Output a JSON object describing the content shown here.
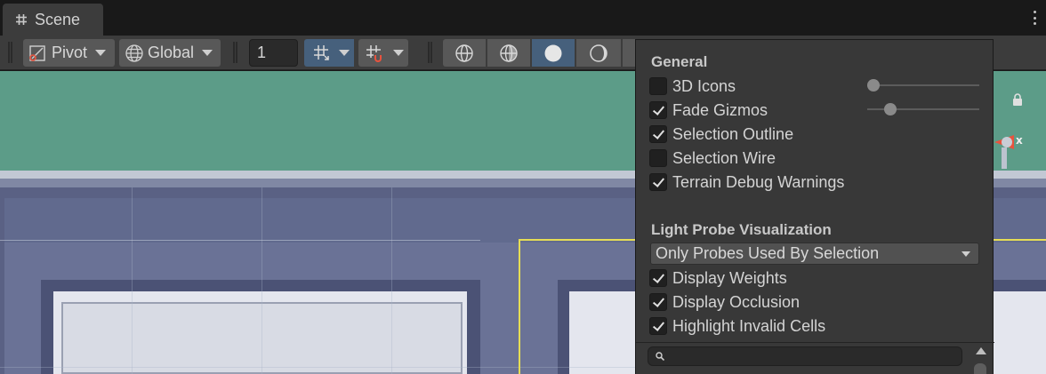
{
  "tab": {
    "title": "Scene",
    "icon": "grid-hash-icon"
  },
  "toolbar": {
    "pivot_label": "Pivot",
    "global_label": "Global",
    "snap_value": "1",
    "grid_snap_icon": "grid-snap-icon",
    "increment_snap_icon": "magnet-grid-icon",
    "shading_modes": [
      "wireframe-sphere-icon",
      "shaded-wireframe-sphere-icon",
      "solid-sphere-icon",
      "moon-sphere-icon"
    ],
    "active_shading": "solid-sphere-icon",
    "orientation_icon": "globe-gizmo-icon"
  },
  "overlay": {
    "general_heading": "General",
    "general_items": [
      {
        "label": "3D Icons",
        "checked": false,
        "slider": 0.0
      },
      {
        "label": "Fade Gizmos",
        "checked": true,
        "slider": 0.2
      },
      {
        "label": "Selection Outline",
        "checked": true
      },
      {
        "label": "Selection Wire",
        "checked": false
      },
      {
        "label": "Terrain Debug Warnings",
        "checked": true
      }
    ],
    "light_probe_heading": "Light Probe Visualization",
    "light_probe_mode": "Only Probes Used By Selection",
    "light_probe_items": [
      {
        "label": "Display Weights",
        "checked": true
      },
      {
        "label": "Display Occlusion",
        "checked": true
      },
      {
        "label": "Highlight Invalid Cells",
        "checked": true
      }
    ],
    "search_placeholder": ""
  },
  "colors": {
    "accent_selection": "#e6dd55",
    "active_toggle": "#46607c",
    "gizmo_x": "#e8533e"
  }
}
